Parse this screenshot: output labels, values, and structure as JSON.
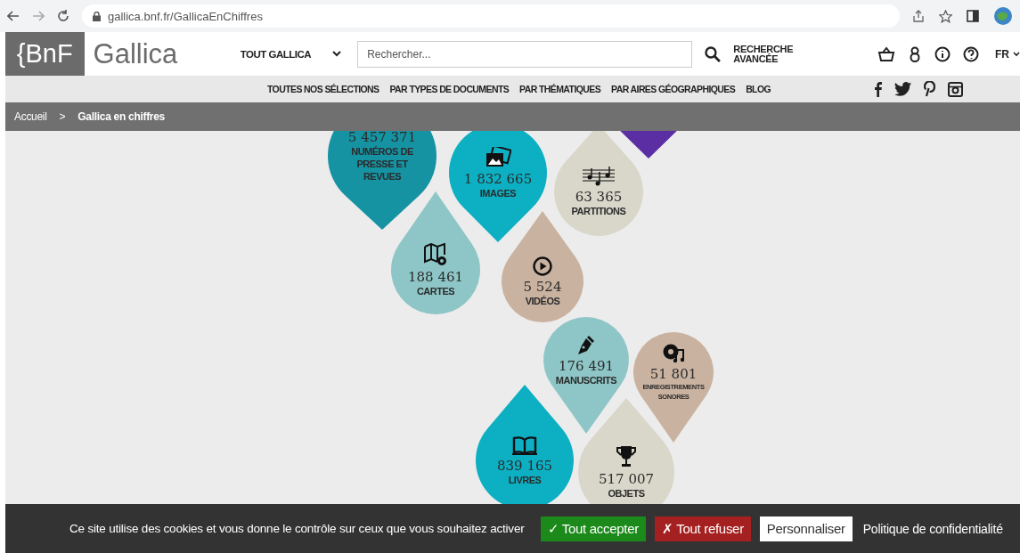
{
  "browser": {
    "url": "gallica.bnf.fr/GallicaEnChiffres"
  },
  "header": {
    "logo": "{BnF",
    "site_name": "Gallica",
    "scope": "TOUT GALLICA",
    "search": {
      "placeholder": "Rechercher..."
    },
    "advanced_search": "RECHERCHE AVANCÉE",
    "language": "FR"
  },
  "nav": {
    "items": [
      "TOUTES NOS SÉLECTIONS",
      "PAR TYPES DE DOCUMENTS",
      "PAR THÉMATIQUES",
      "PAR AIRES GÉOGRAPHIQUES",
      "BLOG"
    ]
  },
  "breadcrumb": [
    {
      "label": "Accueil",
      "current": false
    },
    {
      "label": "Gallica en chiffres",
      "current": true
    }
  ],
  "breadcrumb_separator": ">",
  "drops": [
    {
      "kind": "press",
      "count": "5 457 371",
      "label": "NUMÉROS DE PRESSE ET REVUES",
      "color": "#1693a3"
    },
    {
      "kind": "images",
      "count": "1 832 665",
      "label": "IMAGES",
      "color": "#0db0c3"
    },
    {
      "kind": "scores",
      "count": "63 365",
      "label": "PARTITIONS",
      "color": "#d9d7ca"
    },
    {
      "kind": "blank",
      "color": "#5b2ea3"
    },
    {
      "kind": "maps",
      "count": "188 461",
      "label": "CARTES",
      "color": "#8ec6c7"
    },
    {
      "kind": "videos",
      "count": "5 524",
      "label": "VIDÉOS",
      "color": "#c9b2a0"
    },
    {
      "kind": "manuscripts",
      "count": "176 491",
      "label": "MANUSCRITS",
      "color": "#8ec6c7"
    },
    {
      "kind": "recordings",
      "count": "51 801",
      "label": "ENREGISTREMENTS SONORES",
      "color": "#c9b2a0"
    },
    {
      "kind": "books",
      "count": "839 165",
      "label": "LIVRES",
      "color": "#0db0c3"
    },
    {
      "kind": "objects",
      "count": "517 007",
      "label": "OBJETS",
      "color": "#d9d7ca"
    }
  ],
  "cookie_bar": {
    "message": "Ce site utilise des cookies et vous donne le contrôle sur ceux que vous souhaitez activer",
    "buttons": [
      {
        "kind": "accept",
        "label": "✓ Tout accepter"
      },
      {
        "kind": "refuse",
        "label": "✗ Tout refuser"
      },
      {
        "kind": "customize",
        "label": "Personnaliser"
      },
      {
        "kind": "link",
        "label": "Politique de confidentialité"
      }
    ]
  }
}
